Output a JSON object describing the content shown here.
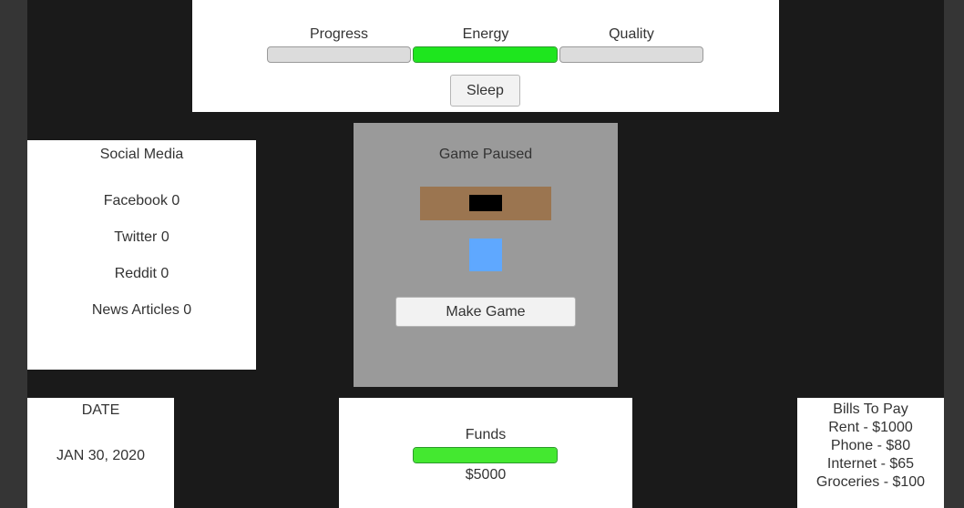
{
  "status": {
    "progress": {
      "label": "Progress",
      "fill": 0
    },
    "energy": {
      "label": "Energy",
      "fill": 1.0
    },
    "quality": {
      "label": "Quality",
      "fill": 0
    },
    "sleep_label": "Sleep"
  },
  "social": {
    "title": "Social Media",
    "items": [
      "Facebook 0",
      "Twitter 0",
      "Reddit 0",
      "News Articles 0"
    ]
  },
  "game": {
    "status_text": "Game Paused",
    "make_game_label": "Make Game"
  },
  "date": {
    "title": "DATE",
    "value": "JAN 30, 2020"
  },
  "funds": {
    "title": "Funds",
    "fill": 1.0,
    "amount": "$5000"
  },
  "bills": {
    "title": "Bills To Pay",
    "items": [
      "Rent - $1000",
      "Phone - $80",
      "Internet - $65",
      "Groceries - $100"
    ]
  },
  "colors": {
    "energy_bar": "#1ee61e",
    "funds_bar": "#44e830",
    "desk": "#9b7550",
    "player": "#5fa8ff",
    "background": "#1a1a1a"
  }
}
